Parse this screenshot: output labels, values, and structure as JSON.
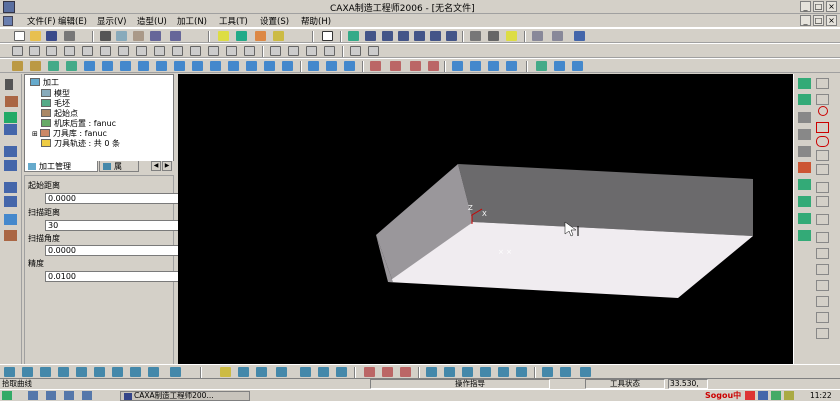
{
  "window": {
    "title": "CAXA制造工程师2006 - [无名文件]",
    "min": "_",
    "max": "□",
    "close": "×"
  },
  "menu": [
    {
      "label": "文件(F)"
    },
    {
      "label": "编辑(E)"
    },
    {
      "label": "显示(V)"
    },
    {
      "label": "造型(U)"
    },
    {
      "label": "加工(N)"
    },
    {
      "label": "工具(T)"
    },
    {
      "label": "设置(S)"
    },
    {
      "label": "帮助(H)"
    }
  ],
  "tree": {
    "root": "加工",
    "items": [
      {
        "label": "模型",
        "icon": "model-icon"
      },
      {
        "label": "毛坯",
        "icon": "stock-icon"
      },
      {
        "label": "起始点",
        "icon": "start-point-icon"
      },
      {
        "label": "机床后置 : fanuc",
        "icon": "machine-post-icon"
      },
      {
        "label": "刀具库 : fanuc",
        "icon": "tool-library-icon"
      },
      {
        "label": "刀具轨迹 : 共 0 条",
        "icon": "toolpath-folder-icon"
      }
    ]
  },
  "tabs": [
    {
      "label": "加工管理"
    },
    {
      "label": "属"
    }
  ],
  "tab_nav": {
    "prev": "◀",
    "next": "▶"
  },
  "props": [
    {
      "label": "起始距离",
      "value": "0.0000"
    },
    {
      "label": "扫描距离",
      "value": "30"
    },
    {
      "label": "扫描角度",
      "value": "0.0000"
    },
    {
      "label": "精度",
      "value": "0.0100"
    }
  ],
  "status": {
    "prompt": "拾取曲线",
    "op_hint": "操作指导",
    "tool_state": "工具状态",
    "coords": "33.530,",
    "time": "11:22"
  },
  "taskbar": {
    "app_label": "CAXA制造工程师200...",
    "ime": "Sogou中"
  },
  "colors": {
    "viewport": "#000000",
    "box_top": "#f0ecf0",
    "box_side_left": "#9a979b",
    "box_side_back": "#6b6a6c",
    "ui_face": "#d4d0c8"
  }
}
